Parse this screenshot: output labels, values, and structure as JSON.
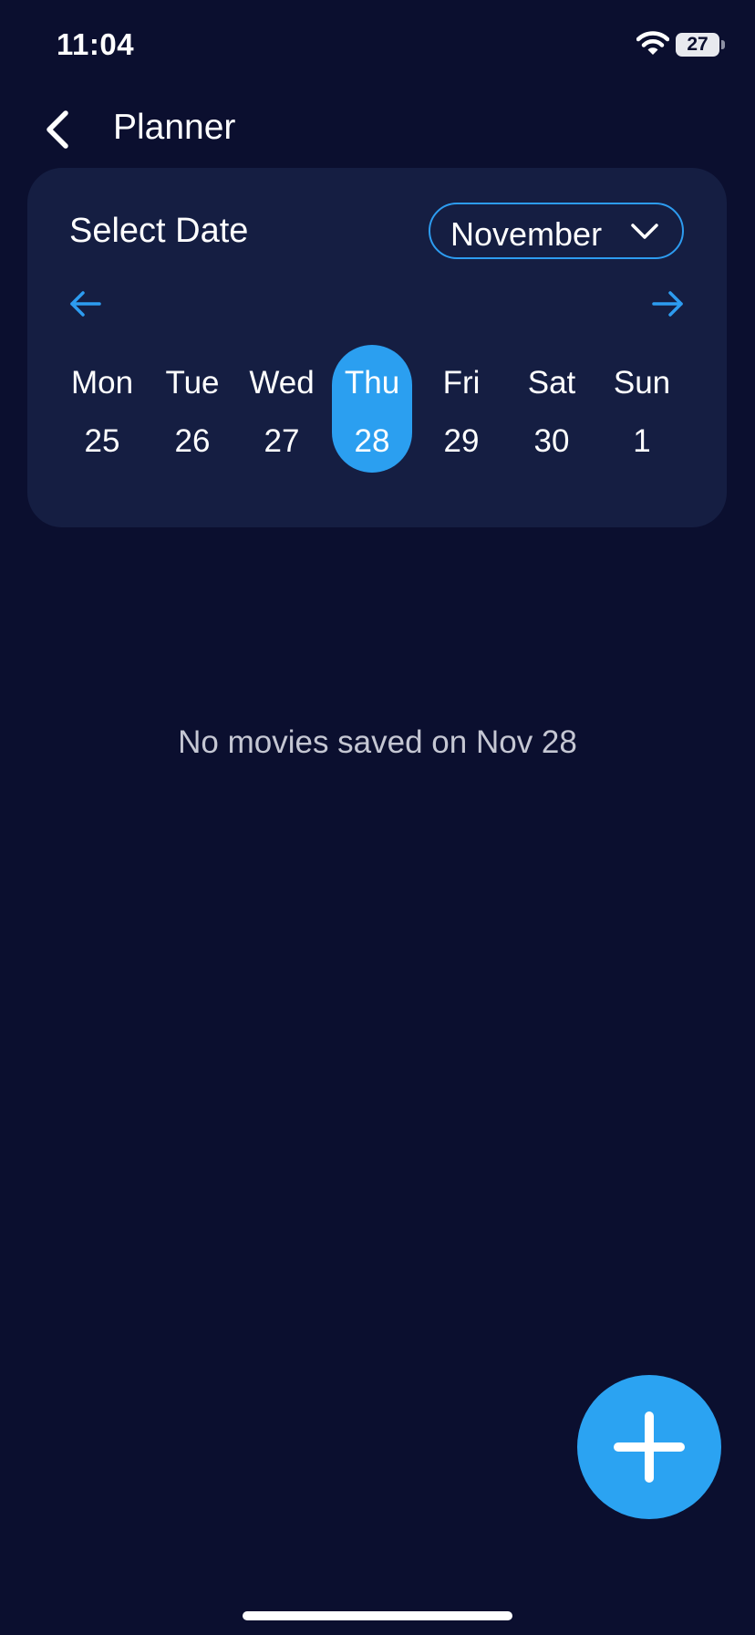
{
  "status_bar": {
    "time": "11:04",
    "battery": "27"
  },
  "header": {
    "title": "Planner",
    "back_icon": "chevron-left-icon"
  },
  "calendar": {
    "title": "Select Date",
    "month": "November",
    "prev_icon": "arrow-left-icon",
    "next_icon": "arrow-right-icon",
    "days": [
      {
        "name": "Mon",
        "num": "25"
      },
      {
        "name": "Tue",
        "num": "26"
      },
      {
        "name": "Wed",
        "num": "27"
      },
      {
        "name": "Thu",
        "num": "28"
      },
      {
        "name": "Fri",
        "num": "29"
      },
      {
        "name": "Sat",
        "num": "30"
      },
      {
        "name": "Sun",
        "num": "1"
      }
    ],
    "selected_index": 3
  },
  "empty_state": {
    "message": "No movies saved on Nov 28"
  },
  "fab": {
    "icon": "plus-icon"
  },
  "colors": {
    "background": "#0b0f2f",
    "card": "#151e42",
    "accent": "#2b9ff0",
    "muted_text": "#c5c7d3"
  }
}
